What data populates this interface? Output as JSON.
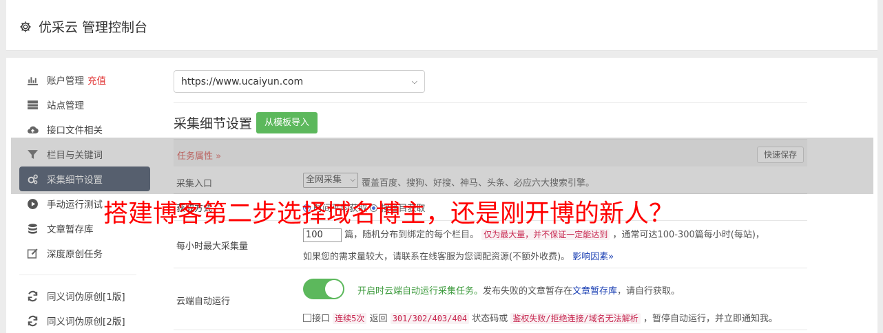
{
  "header": {
    "title": "优采云 管理控制台",
    "icon": "gear-icon"
  },
  "sidebar": {
    "items": [
      {
        "label": "账户管理",
        "badge": "充值",
        "icon": "bar-chart-icon"
      },
      {
        "label": "站点管理",
        "icon": "server-icon"
      },
      {
        "label": "接口文件相关",
        "icon": "cloud-upload-icon"
      },
      {
        "label": "栏目与关键词",
        "icon": "filter-icon"
      },
      {
        "label": "采集细节设置",
        "icon": "cogs-icon",
        "active": true
      },
      {
        "label": "手动运行测试",
        "icon": "play-circle-icon"
      },
      {
        "label": "文章暂存库",
        "icon": "database-icon"
      },
      {
        "label": "深度原创任务",
        "icon": "edit-icon"
      },
      {
        "label": "同义词伪原创[1版]",
        "icon": "refresh-icon"
      },
      {
        "label": "同义词伪原创[2版]",
        "icon": "refresh-icon"
      }
    ]
  },
  "site_select": {
    "value": "https://www.ucaiyun.com"
  },
  "section": {
    "title": "采集细节设置",
    "import_button": "从模板导入"
  },
  "task_bar": {
    "title": "任务属性 »",
    "quick_save": "快速保存"
  },
  "rows": {
    "collect_entry": {
      "label": "采集入口",
      "select_value": "全网采集",
      "desc": "覆盖百度、搜狗、好搜、神马、头条、必应六大搜索引擎。"
    },
    "mode": {
      "label": "获取方式",
      "radio_text": "时间平均获取",
      "radio2_text": "按栏目获取"
    },
    "max_per_hour": {
      "label": "每小时最大采集量",
      "input_value": "100",
      "text1": "篇，随机分布到绑定的每个栏目。",
      "warn1": "仅为最大量，并不保证一定能达到",
      "text2": "，通常可达100-300篇每小时(每站)，",
      "text3": "如果您的需求量较大，请联系在线客服为您调配资源(不额外收费)。",
      "link": "影响因素»"
    },
    "cloud_run": {
      "label": "云端自动运行",
      "green_text": "开启时云端自动运行采集任务。",
      "text1": "发布失败的文章暂存在",
      "link": "文章暂存库",
      "text2": "，请自行获取。",
      "check_label": "接口",
      "warn1": "连续5次",
      "text3": "返回",
      "warn2": "301/302/403/404",
      "text4": "状态码或",
      "warn3": "鉴权失败/拒绝连接/域名无法解析",
      "text5": "，暂停自动运行，并立即通知我。"
    }
  },
  "watermark": "搭建博客第二步选择域名博主，还是刚开博的新人？",
  "colors": {
    "active_nav": "#3f4e65",
    "green": "#5cb85c",
    "danger": "#d9534f",
    "watermark": "#ff0000"
  }
}
